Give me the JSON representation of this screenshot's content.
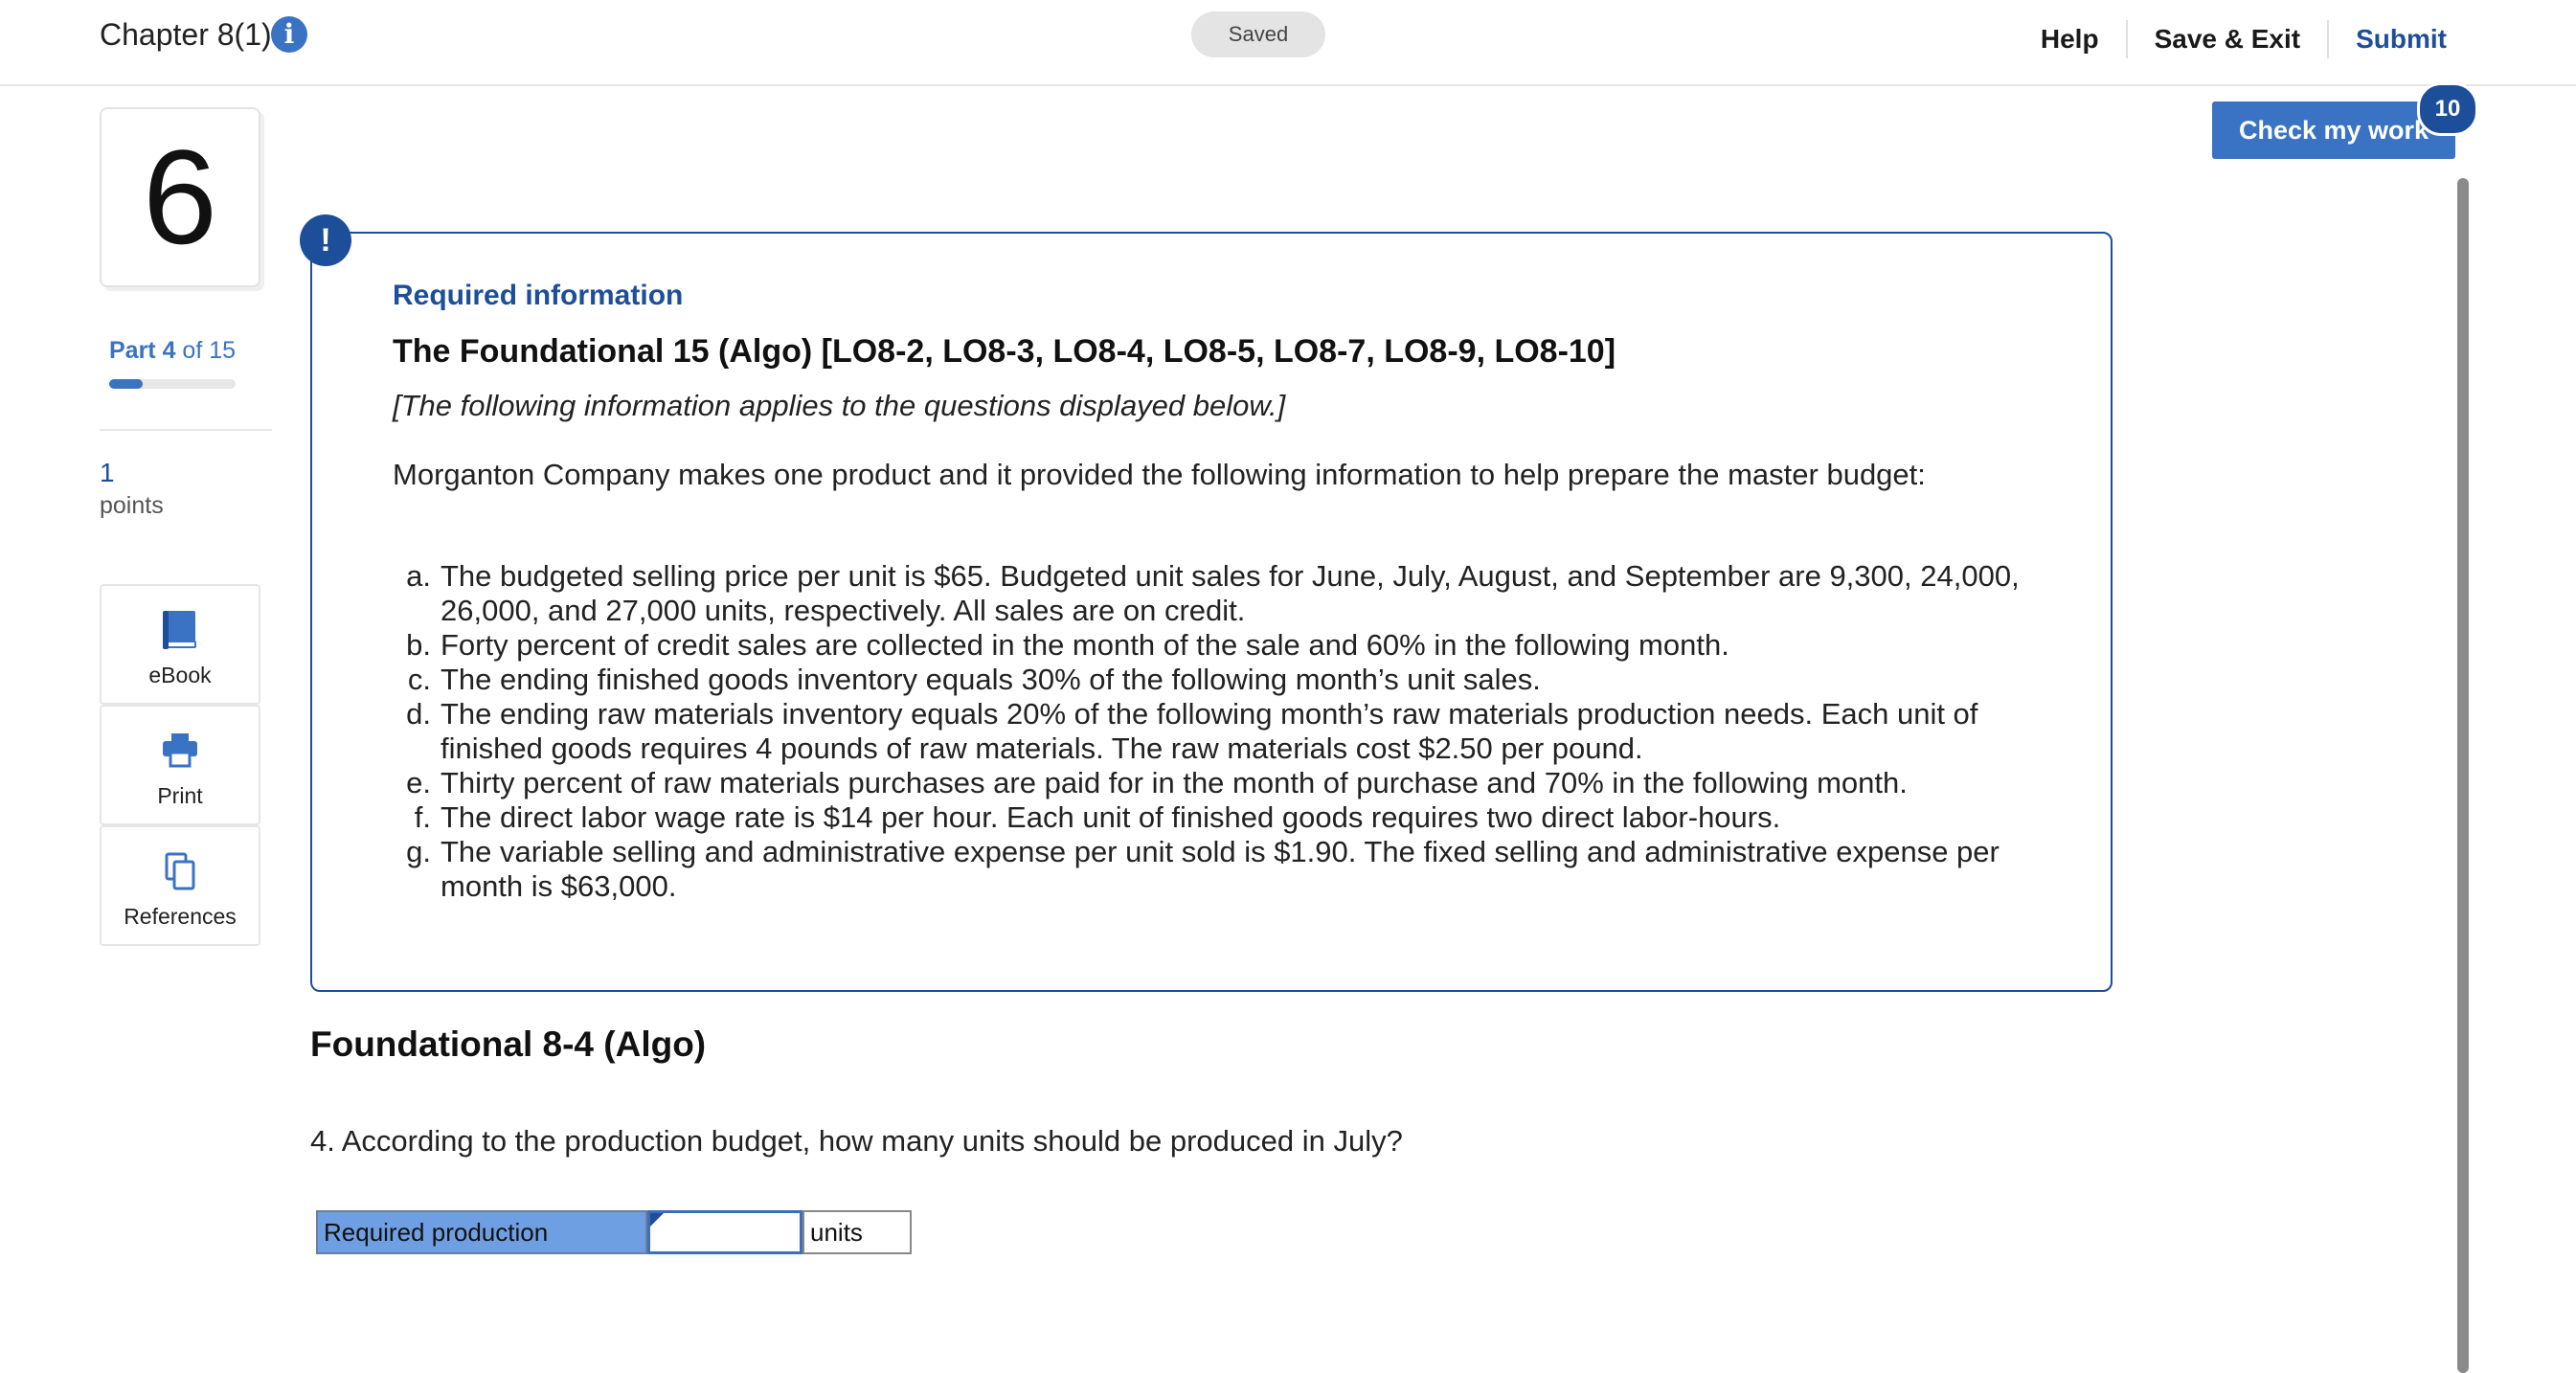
{
  "header": {
    "chapter_title": "Chapter 8(1)",
    "saved_label": "Saved",
    "nav": {
      "help": "Help",
      "save_exit": "Save & Exit",
      "submit": "Submit"
    }
  },
  "sidebar": {
    "question_number": "6",
    "part_current": "Part 4",
    "part_of": " of 15",
    "part_progress_fraction": 0.267,
    "points_value": "1",
    "points_label": "points",
    "tools": [
      {
        "label": "eBook",
        "icon": "book-icon"
      },
      {
        "label": "Print",
        "icon": "printer-icon"
      },
      {
        "label": "References",
        "icon": "copy-icon"
      }
    ]
  },
  "check_work": {
    "label": "Check my work",
    "badge": "10"
  },
  "required_info": {
    "alert_glyph": "!",
    "heading": "Required information",
    "title": "The Foundational 15 (Algo) [LO8-2, LO8-3, LO8-4, LO8-5, LO8-7, LO8-9, LO8-10]",
    "note": "[The following information applies to the questions displayed below.]",
    "intro": "Morganton Company makes one product and it provided the following information to help prepare the master budget:",
    "items": [
      {
        "letter": "a.",
        "text": "The budgeted selling price per unit is $65. Budgeted unit sales for June, July, August, and September are 9,300, 24,000, 26,000, and 27,000 units, respectively. All sales are on credit."
      },
      {
        "letter": "b.",
        "text": "Forty percent of credit sales are collected in the month of the sale and 60% in the following month."
      },
      {
        "letter": "c.",
        "text": "The ending finished goods inventory equals 30% of the following month’s unit sales."
      },
      {
        "letter": "d.",
        "text": "The ending raw materials inventory equals 20% of the following month’s raw materials production needs. Each unit of finished goods requires 4 pounds of raw materials. The raw materials cost $2.50 per pound."
      },
      {
        "letter": "e.",
        "text": "Thirty percent of raw materials purchases are paid for in the month of purchase and 70% in the following month."
      },
      {
        "letter": "f.",
        "text": "The direct labor wage rate is $14 per hour. Each unit of finished goods requires two direct labor-hours."
      },
      {
        "letter": "g.",
        "text": "The variable selling and administrative expense per unit sold is $1.90. The fixed selling and administrative expense per month is $63,000."
      }
    ]
  },
  "question": {
    "title": "Foundational 8-4 (Algo)",
    "text": "4. According to the production budget, how many units should be produced in July?",
    "answer_label": "Required production",
    "answer_value": "",
    "answer_unit": "units"
  },
  "colors": {
    "brand_blue": "#1d4e9a",
    "accent_blue": "#3a73c4",
    "answer_label_bg": "#6f9fe3"
  }
}
